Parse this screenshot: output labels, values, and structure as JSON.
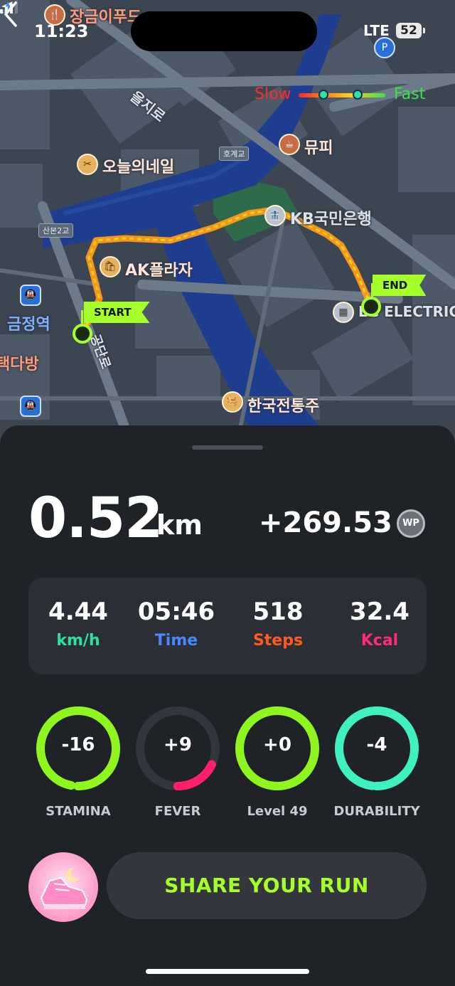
{
  "status_bar": {
    "time": "11:23",
    "network": "LTE",
    "battery": "52"
  },
  "map": {
    "speed_legend": {
      "slow": "Slow",
      "fast": "Fast"
    },
    "flags": {
      "start": "START",
      "end": "END"
    },
    "places": {
      "top_left": "장금이푸드",
      "street_top": "을지로",
      "nail": "오늘의네일",
      "bridge_1": "호계교",
      "cafe": "뮤피",
      "bridge_2": "산본2교",
      "bank": "KB국민은행",
      "plaza": "AK플라자",
      "station": "금정역",
      "electric": "LG ELECTRIC",
      "left_mid": "택다방",
      "street_mid": "공단로",
      "market": "한국전통주"
    },
    "colors": {
      "route_slow": "#ff2a2a",
      "route_mid": "#ffb21a",
      "route_fast": "#3fe04a",
      "accent": "#a6ff2a"
    }
  },
  "summary": {
    "distance": "0.52",
    "distance_unit": "km",
    "wp_amount": "+269.53",
    "wp_badge": "WP"
  },
  "stats": [
    {
      "value": "4.44",
      "label": "km/h",
      "color": "#2fe0a0"
    },
    {
      "value": "05:46",
      "label": "Time",
      "color": "#4a86ff"
    },
    {
      "value": "518",
      "label": "Steps",
      "color": "#ff5a1f"
    },
    {
      "value": "32.4",
      "label": "Kcal",
      "color": "#ff2a7a"
    }
  ],
  "gauges": [
    {
      "value": "-16",
      "label": "STAMINA",
      "color": "#8ef51f",
      "fill": 0.97
    },
    {
      "value": "+9",
      "label": "FEVER",
      "color": "#ff1f6a",
      "fill": 0.18
    },
    {
      "value": "+0",
      "label": "Level 49",
      "color": "#8ef51f",
      "fill": 1.0
    },
    {
      "value": "-4",
      "label": "DURABILITY",
      "color": "#3ff0c0",
      "fill": 0.98
    }
  ],
  "share_button": "SHARE YOUR RUN"
}
